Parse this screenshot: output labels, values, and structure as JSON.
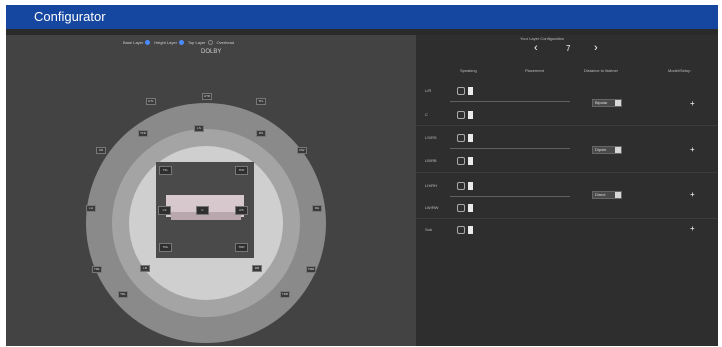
{
  "app": {
    "title": "Configurator"
  },
  "layers": {
    "items": [
      "Base Layer",
      "Height Layer",
      "Top Layer",
      "Overhead"
    ]
  },
  "room": {
    "label": "DOLBY"
  },
  "config": {
    "title": "Your Layer Configuration",
    "value": "7",
    "prev": "‹",
    "next": "›"
  },
  "columns": [
    "Speaking",
    "Placement",
    "Distance to listener",
    "Model/Setup"
  ],
  "rows": [
    {
      "label": "L/R"
    },
    {
      "label": "C"
    },
    {
      "label": "LS/RS"
    },
    {
      "label": "LB/RB"
    },
    {
      "label": "LH/RH"
    },
    {
      "label": "LW/RW"
    },
    {
      "label": "Sub"
    }
  ],
  "groups": [
    {
      "dropdown": "Bipolar",
      "plus": "+"
    },
    {
      "dropdown": "Dipole",
      "plus": "+"
    },
    {
      "dropdown": "Direct",
      "plus": "+"
    },
    {
      "plus": "+"
    }
  ],
  "speakers": {
    "outer": [
      "HTL",
      "HTR",
      "TFL",
      "TFR",
      "LS",
      "RS",
      "LW",
      "RW",
      "LH",
      "RH",
      "TML",
      "TMR",
      "LB",
      "RB",
      "TRL",
      "TRR"
    ],
    "inner": [
      "TFL",
      "TFR",
      "LS",
      "C",
      "RS",
      "TRL",
      "TRR",
      "LB",
      "RB"
    ]
  },
  "colors": {
    "titlebar": "#1546a0",
    "accent": "#4a8cff"
  }
}
